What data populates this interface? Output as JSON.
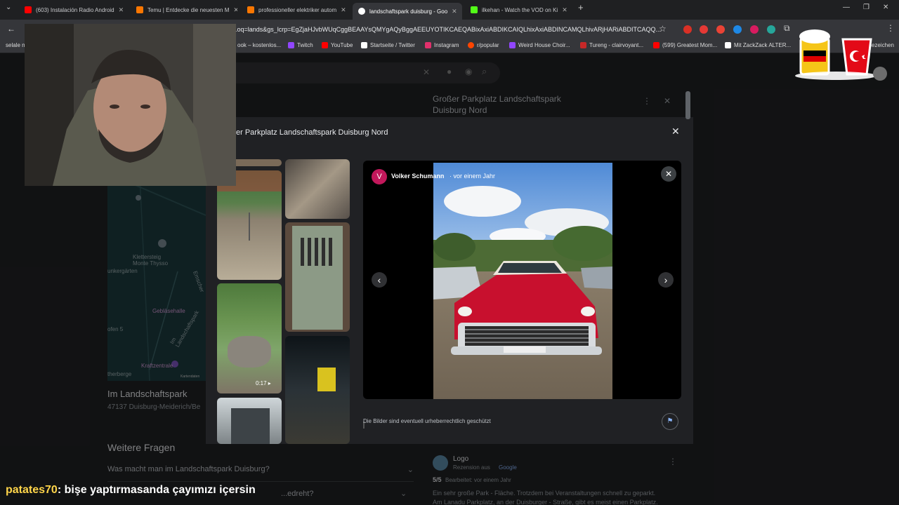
{
  "tabs": [
    {
      "label": "(603) Instalación Radio Android",
      "color": "#ff0000"
    },
    {
      "label": "Temu | Entdecke die neuesten M",
      "color": "#fb7701"
    },
    {
      "label": "professioneller elektriker autom",
      "color": "#fb7701"
    },
    {
      "label": "landschaftspark duisburg - Goo",
      "color": "#4285f4",
      "active": true
    },
    {
      "label": "ilkehan - Watch the VOD on Ki",
      "color": "#53fc18"
    }
  ],
  "new_tab_label": "+",
  "address": {
    "url": "...oq=lands&gs_lcrp=EgZjaHJvbWUqCggBEAAYsQMYgAQyBggAEEUYOTIKCAEQABixAxiABDIKCAIQLhixAxiABDINCAMQLhivARjHARiABDITCAQQ..."
  },
  "bookmarks": {
    "left_label": "selale n",
    "items": [
      {
        "label": "ook – kostenlos...",
        "color": "#1877f2"
      },
      {
        "label": "Twitch",
        "color": "#9146ff"
      },
      {
        "label": "YouTube",
        "color": "#ff0000"
      },
      {
        "label": "Startseite / Twitter",
        "color": "#ffffff"
      },
      {
        "label": "Instagram",
        "color": "#e1306c"
      },
      {
        "label": "r/popular",
        "color": "#ff4500"
      },
      {
        "label": "Weird House Choir...",
        "color": "#9146ff"
      },
      {
        "label": "Tureng - clairvoyant...",
        "color": "#c62828"
      },
      {
        "label": "(599) Greatest Mom...",
        "color": "#ff0000"
      },
      {
        "label": "Mit ZackZack ALTER...",
        "color": "#ffffff"
      }
    ],
    "right_label": "Lesezeichen"
  },
  "page": {
    "place_title": "Großer Parkplatz Landschaftspark Duisburg Nord",
    "map_labels": [
      "Klettersteig Monte Thysso",
      "Gebläsehalle",
      "Kraftzentrale",
      "Im Landschaftspark",
      "unkergärten",
      "ofen 5",
      "therberge",
      "Kartendaten",
      "Emscher"
    ],
    "address_line1": "Im Landschaftspark",
    "address_line2": "47137 Duisburg-Meiderich/Be",
    "more_questions": "Weitere Fragen",
    "question1": "Was macht man im Landschaftspark Duisburg?",
    "question2": "...edreht?",
    "review": {
      "author": "Logo",
      "role": "Rezension aus",
      "source": "Google",
      "rating": "5/5",
      "edited": "Bearbeitet: vor einem Jahr",
      "text": "Ein sehr große Park - Fläche. Trotzdem bei Veranstaltungen schnell zu geparkt. Am Lanadu Parkplatz, an der Duisburger - Straße, gibt es meist einen Parkplatz."
    }
  },
  "dialog": {
    "title": "er Parkplatz Landschaftspark Duisburg Nord",
    "close": "✕",
    "video_duration": "0:17",
    "photo_author": "Volker Schumann",
    "photo_author_initial": "V",
    "photo_time": "vor einem Jahr",
    "copyright_note": "Die Bilder sind eventuell urheberrechtlich geschützt"
  },
  "chat": {
    "user": "patates70",
    "message": ": bişe yaptırmasanda çayımızı içersin"
  },
  "colors": {
    "accent_blue": "#8ab4f8",
    "avatar_pink": "#c2185b",
    "car_red": "#c8102e"
  }
}
